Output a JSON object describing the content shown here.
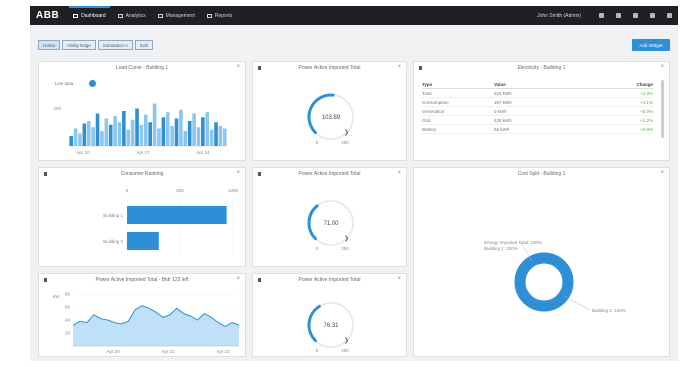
{
  "topbar": {
    "logo": "ABB",
    "nav": [
      {
        "label": "Dashboard",
        "icon": "dashboard-icon",
        "active": true
      },
      {
        "label": "Analytics",
        "icon": "analytics-icon",
        "active": false
      },
      {
        "label": "Management",
        "icon": "management-icon",
        "active": false
      },
      {
        "label": "Reports",
        "icon": "reports-icon",
        "active": false
      }
    ],
    "user": "John Smith (Admin)",
    "icons": [
      "bell-icon",
      "settings-icon",
      "help-icon",
      "grid-icon",
      "user-icon"
    ]
  },
  "subbar": {
    "chips": [
      "Home",
      "Ability Edge",
      "Substation A",
      "Edit"
    ],
    "add_button": "Add Widget"
  },
  "panels": {
    "load_curve": {
      "title": "Load Curve - Building 1",
      "toggle_label": "Live data"
    },
    "gauge1": {
      "title": "Power Active Imported Total",
      "value": "103.89",
      "min": "0",
      "max": "200"
    },
    "gauge2": {
      "title": "Power Active Imported Total",
      "value": "71.00",
      "min": "0",
      "max": "200"
    },
    "gauge3": {
      "title": "Power Active Imported Total",
      "value": "76.31",
      "min": "0",
      "max": "200"
    },
    "electricity": {
      "title": "Electricity - Building 1",
      "headers": [
        "Type",
        "Value",
        "Change"
      ],
      "rows": [
        [
          "Total",
          "615 kWh",
          "+2.3%"
        ],
        [
          "Consumption",
          "187 kWh",
          "+4.1%"
        ],
        [
          "Generation",
          "0 kWh",
          "+0.0%"
        ],
        [
          "Grid",
          "428 kWh",
          "+1.2%"
        ],
        [
          "Battery",
          "56 kWh",
          "+0.8%"
        ]
      ]
    },
    "consumer_ranking": {
      "title": "Consumer Ranking"
    },
    "cost_split": {
      "title": "Cost Split - Building 1",
      "label_top": "Energy Imported Total: 100%",
      "label_top2": "Building 1: 100%",
      "label_bottom": "Building 1: 100%"
    },
    "power_trend": {
      "title": "Power Active Imported Total - Bldr 123 left"
    }
  },
  "chart_data": [
    {
      "type": "bar",
      "title": "Load Curve - Building 1",
      "categories": [
        "1",
        "2",
        "3",
        "4",
        "5",
        "6",
        "7",
        "8",
        "9",
        "10",
        "11",
        "12",
        "13",
        "14",
        "15",
        "16",
        "17",
        "18",
        "19",
        "20",
        "21",
        "22",
        "23",
        "24",
        "25",
        "26",
        "27",
        "28",
        "29",
        "30",
        "31",
        "32",
        "33",
        "34",
        "35",
        "36"
      ],
      "values": [
        8,
        14,
        10,
        18,
        20,
        15,
        26,
        12,
        22,
        17,
        24,
        19,
        28,
        13,
        21,
        30,
        17,
        25,
        19,
        34,
        14,
        23,
        27,
        16,
        22,
        29,
        12,
        20,
        26,
        15,
        23,
        27,
        13,
        19,
        16,
        14
      ],
      "ylim": [
        0,
        40
      ],
      "xticks": [
        "Apr 10",
        "Apr 17",
        "Apr 24"
      ],
      "ytick": "200"
    },
    {
      "type": "bar",
      "orientation": "horizontal",
      "title": "Consumer Ranking",
      "categories": [
        "Building 1",
        "Building 2"
      ],
      "values": [
        940,
        300
      ],
      "ylim": [
        0,
        1000
      ],
      "xticks": [
        "0",
        "500",
        "1000"
      ]
    },
    {
      "type": "pie",
      "title": "Cost Split - Building 1",
      "categories": [
        "Building 1"
      ],
      "values": [
        100
      ]
    },
    {
      "type": "area",
      "title": "Power Active Imported Total - Bldr 123 left",
      "ylabel": "kW",
      "values": [
        32,
        38,
        36,
        48,
        42,
        40,
        36,
        34,
        38,
        56,
        62,
        58,
        52,
        44,
        48,
        58,
        50,
        46,
        40,
        50,
        44,
        36,
        30,
        36,
        32
      ],
      "ylim": [
        0,
        80
      ],
      "yticks": [
        "80",
        "60",
        "40",
        "20"
      ],
      "xticks": [
        "Apr 20",
        "Apr 21",
        "Apr 22"
      ]
    }
  ]
}
